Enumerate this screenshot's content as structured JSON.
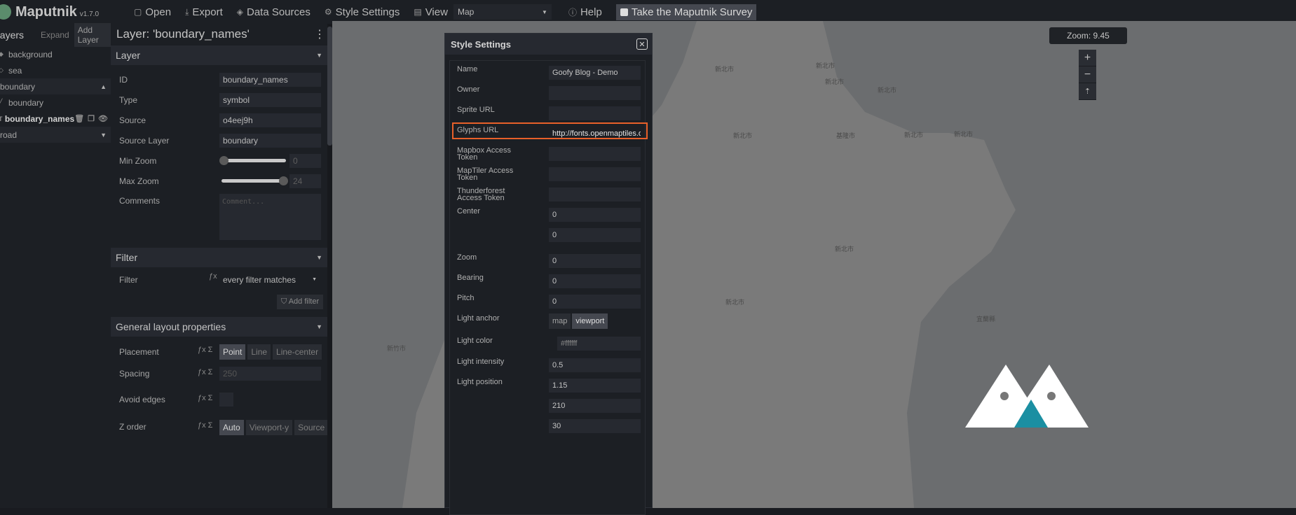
{
  "app": {
    "title": "Maputnik",
    "version": "v1.7.0"
  },
  "nav": {
    "open": "Open",
    "export": "Export",
    "data_sources": "Data Sources",
    "style_settings": "Style Settings",
    "view": "View",
    "view_value": "Map",
    "help": "Help",
    "survey": "Take the Maputnik Survey"
  },
  "layers": {
    "title": "Layers",
    "expand": "Expand",
    "add_layer": "Add Layer",
    "items": [
      {
        "label": "background",
        "type": "fill"
      },
      {
        "label": "sea",
        "type": "fill"
      }
    ],
    "group_boundary": "boundary",
    "boundary_items": [
      {
        "label": "boundary",
        "type": "line"
      },
      {
        "label": "boundary_names",
        "type": "symbol"
      }
    ],
    "group_road": "road"
  },
  "editor": {
    "title": "Layer: 'boundary_names'",
    "layer_section": "Layer",
    "fields": {
      "id_label": "ID",
      "id_value": "boundary_names",
      "type_label": "Type",
      "type_value": "symbol",
      "source_label": "Source",
      "source_value": "o4eej9h",
      "source_layer_label": "Source Layer",
      "source_layer_value": "boundary",
      "min_zoom_label": "Min Zoom",
      "min_zoom_value": "0",
      "max_zoom_label": "Max Zoom",
      "max_zoom_value": "24",
      "comments_label": "Comments",
      "comments_placeholder": "Comment..."
    },
    "filter_section": "Filter",
    "filter_label": "Filter",
    "filter_value": "every filter matches",
    "add_filter": "Add filter",
    "layout_section": "General layout properties",
    "placement_label": "Placement",
    "placement_options": [
      "Point",
      "Line",
      "Line-center"
    ],
    "spacing_label": "Spacing",
    "spacing_value": "250",
    "avoid_edges_label": "Avoid edges",
    "z_order_label": "Z order",
    "z_order_options": [
      "Auto",
      "Viewport-y",
      "Source"
    ]
  },
  "map": {
    "zoom_text": "Zoom: 9.45",
    "places": [
      "新北市",
      "新北市",
      "新北市",
      "新北市",
      "新北市",
      "基隆市",
      "新北市",
      "新北市",
      "新北市",
      "新北市",
      "新竹市",
      "宜蘭縣"
    ]
  },
  "style_settings": {
    "title": "Style Settings",
    "name_label": "Name",
    "name_value": "Goofy Blog - Demo",
    "owner_label": "Owner",
    "owner_value": "",
    "sprite_label": "Sprite URL",
    "sprite_value": "",
    "glyphs_label": "Glyphs URL",
    "glyphs_value": "http://fonts.openmaptiles.or",
    "mapbox_label": "Mapbox Access Token",
    "maptiler_label": "MapTiler Access Token",
    "thunderforest_label": "Thunderforest Access Token",
    "center_label": "Center",
    "center_lon": "0",
    "center_lat": "0",
    "zoom_label": "Zoom",
    "zoom_value": "0",
    "bearing_label": "Bearing",
    "bearing_value": "0",
    "pitch_label": "Pitch",
    "pitch_value": "0",
    "light_anchor_label": "Light anchor",
    "light_anchor_options": [
      "map",
      "viewport"
    ],
    "light_color_label": "Light color",
    "light_color_value": "#ffffff",
    "light_intensity_label": "Light intensity",
    "light_intensity_value": "0.5",
    "light_position_label": "Light position",
    "light_position_values": [
      "1.15",
      "210",
      "30"
    ]
  },
  "colors": {
    "highlight": "#e8602a",
    "accent": "#1b8fa2"
  }
}
